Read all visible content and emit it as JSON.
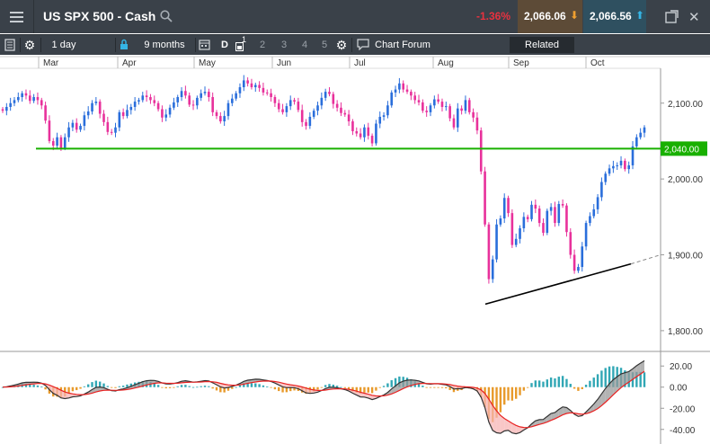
{
  "window": {
    "title": "US SPX 500 - Cash",
    "change": "-1.36%",
    "bid": "2,066.06",
    "ask": "2,066.56",
    "colors": {
      "bg": "#3a4149",
      "bid_bg": "#5d4b37",
      "ask_bg": "#2f5060",
      "change": "#e8313f",
      "bid_arrow": "#f0a030",
      "ask_arrow": "#35b5e5"
    },
    "icons": [
      "menu-icon",
      "search-icon",
      "popout-icon",
      "close-icon"
    ]
  },
  "toolbar": {
    "interval": "1 day",
    "period": "9 months",
    "draw_label": "D",
    "layout_count": "1",
    "layouts": [
      "2",
      "3",
      "4",
      "5"
    ],
    "chart_forum": "Chart Forum",
    "related": "Related",
    "icons": [
      "list-icon",
      "settings-icon",
      "lock-icon",
      "calendar-icon",
      "layout-icon",
      "settings-icon",
      "forum-icon"
    ]
  },
  "chart_data": [
    {
      "type": "candlestick",
      "x_ticks": [
        "Mar",
        "Apr",
        "May",
        "Jun",
        "Jul",
        "Aug",
        "Sep",
        "Oct"
      ],
      "y_ticks": [
        "2,100.00",
        "2,000.00",
        "1,900.00",
        "1,800.00"
      ],
      "ylim": [
        1775,
        2140
      ],
      "current_price_label": "2,040.00",
      "horizontal_line": {
        "value": 2040,
        "color": "#19b000"
      },
      "trendline": {
        "color": "#000000",
        "from": {
          "x": "Aug-24",
          "y": 1835
        },
        "to": {
          "x": "Oct-21",
          "y": 1888
        },
        "extended_to": {
          "x": "Oct-30",
          "y": 1900
        }
      },
      "colors": {
        "up": "#2a6edb",
        "down": "#e8319b"
      },
      "closes": [
        2090,
        2095,
        2100,
        2104,
        2108,
        2113,
        2110,
        2103,
        2108,
        2104,
        2097,
        2077,
        2050,
        2044,
        2055,
        2041,
        2055,
        2068,
        2074,
        2065,
        2070,
        2084,
        2089,
        2100,
        2102,
        2086,
        2075,
        2062,
        2061,
        2068,
        2088,
        2083,
        2091,
        2095,
        2102,
        2104,
        2110,
        2108,
        2104,
        2100,
        2092,
        2081,
        2085,
        2094,
        2101,
        2108,
        2116,
        2110,
        2098,
        2097,
        2107,
        2113,
        2115,
        2108,
        2088,
        2083,
        2076,
        2083,
        2100,
        2106,
        2113,
        2121,
        2130,
        2126,
        2121,
        2124,
        2120,
        2114,
        2113,
        2108,
        2100,
        2092,
        2088,
        2096,
        2104,
        2102,
        2091,
        2075,
        2070,
        2082,
        2090,
        2097,
        2107,
        2115,
        2112,
        2099,
        2094,
        2087,
        2085,
        2076,
        2063,
        2060,
        2055,
        2068,
        2057,
        2047,
        2073,
        2082,
        2084,
        2097,
        2114,
        2118,
        2126,
        2118,
        2115,
        2110,
        2104,
        2101,
        2090,
        2088,
        2097,
        2105,
        2102,
        2095,
        2096,
        2080,
        2068,
        2093,
        2090,
        2104,
        2088,
        2081,
        2064,
        2010,
        1940,
        1868,
        1894,
        1940,
        1948,
        1975,
        1955,
        1913,
        1921,
        1935,
        1950,
        1947,
        1966,
        1961,
        1942,
        1929,
        1958,
        1963,
        1942,
        1967,
        1965,
        1930,
        1900,
        1879,
        1884,
        1911,
        1942,
        1951,
        1960,
        1976,
        1996,
        2007,
        2014,
        2017,
        2018,
        2024,
        2013,
        2018,
        2043,
        2055,
        2061,
        2068
      ]
    },
    {
      "type": "macd",
      "y_ticks": [
        "20.00",
        "0.00",
        "-20.00",
        "-40.00"
      ],
      "ylim": [
        -47,
        27
      ],
      "colors": {
        "hist_pos": "#31a7b5",
        "hist_neg": "#e89a2b",
        "macd": "#333333",
        "signal": "#e82222",
        "fill_up": "#9a9a9a",
        "fill_down": "#f7b4b4"
      }
    }
  ]
}
